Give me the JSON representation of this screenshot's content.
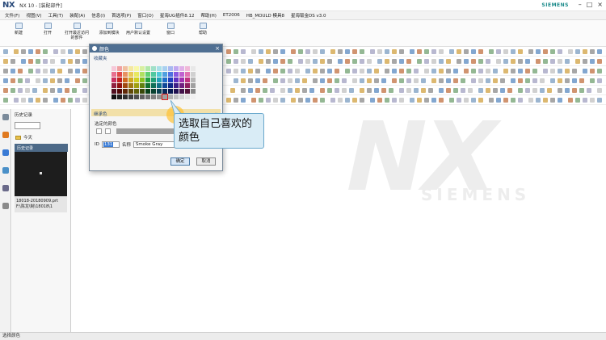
{
  "window": {
    "logo": "NX",
    "title": "NX 10 - [装配部件]",
    "brand": "SIEMENS",
    "controls": [
      "–",
      "□",
      "×"
    ]
  },
  "menu": [
    "文件(F)",
    "视图(V)",
    "工具(T)",
    "装配(A)",
    "信息(I)",
    "首选项(P)",
    "窗口(O)",
    "星海UG插件8.12",
    "帮助(H)",
    "ET2006",
    "HB_MOULD 模具8",
    "星海钣金DS v3.0"
  ],
  "ribbon": [
    {
      "label": "新建"
    },
    {
      "label": "打开"
    },
    {
      "label": "打开最近访问的部件"
    },
    {
      "label": "添加到模块"
    },
    {
      "label": "用户默认设置"
    },
    {
      "label": "窗口"
    },
    {
      "label": "帮助"
    }
  ],
  "navigator": {
    "title": "历史记录",
    "group": "今天",
    "history_tab": "历史记录",
    "file_line1": "18018-20180909.prt",
    "file_line2": "F:\\陈龙\\制\\18018\\1"
  },
  "dialog": {
    "title": "颜色",
    "close": "×",
    "favorites_label": "收藏夹",
    "inherited_label": "继承色",
    "selected_label": "选定的颜色",
    "id_label": "ID",
    "id_value": "131",
    "name_label": "名称",
    "name_value": "Smoke Gray",
    "ok": "确定",
    "cancel": "取消",
    "selected_color": "#a0a0a0",
    "palette": [
      "#f6c8d8",
      "#f0a0a0",
      "#f0c0a0",
      "#f4e8a0",
      "#f8f8a8",
      "#d8f0a0",
      "#b0e8a8",
      "#a0e0c8",
      "#a8e0e8",
      "#a8d0f0",
      "#a8b8f0",
      "#c0a8f0",
      "#e0b0e8",
      "#f0b8d8",
      "#e8e8e8",
      "#e87090",
      "#e04848",
      "#e89060",
      "#e8c858",
      "#e8e860",
      "#b0e060",
      "#60d070",
      "#50c8a0",
      "#50c8d8",
      "#50a0e0",
      "#5070e0",
      "#8a58e0",
      "#c060d0",
      "#e070b0",
      "#d0d0d0",
      "#c83060",
      "#c02020",
      "#d06820",
      "#d0a820",
      "#d0d020",
      "#88c020",
      "#20a040",
      "#20a078",
      "#20a0b8",
      "#2070c8",
      "#2040c0",
      "#6030c0",
      "#a030b0",
      "#c03080",
      "#b8b8b8",
      "#902040",
      "#901010",
      "#a04810",
      "#a07810",
      "#a0a010",
      "#608010",
      "#107030",
      "#107058",
      "#107088",
      "#104898",
      "#102888",
      "#402088",
      "#702080",
      "#902060",
      "#a0a0a0",
      "#501020",
      "#500808",
      "#602808",
      "#604808",
      "#606008",
      "#384808",
      "#084018",
      "#084030",
      "#084050",
      "#082858",
      "#081850",
      "#201050",
      "#401048",
      "#501038",
      "#888888",
      "#101010",
      "#202020",
      "#303030",
      "#404040",
      "#505050",
      "#606060",
      "#707070",
      "#808080",
      "#909090",
      "#a0a0a0",
      "#b0b0b0",
      "#c0c0c0",
      "#d0d0d0",
      "#e0e0e0",
      "#f0f0f0"
    ],
    "selected_index": 84
  },
  "callout": {
    "line1": "选取自己喜欢的",
    "line2": "颜色"
  },
  "status": "选择颜色"
}
